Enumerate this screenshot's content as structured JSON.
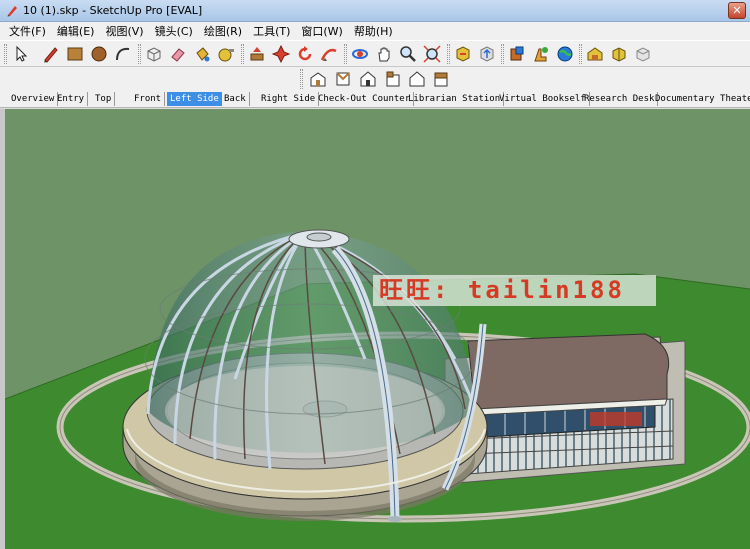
{
  "window": {
    "title": "10 (1).skp - SketchUp Pro [EVAL]",
    "close_glyph": "✕"
  },
  "menu": [
    "文件(F)",
    "编辑(E)",
    "视图(V)",
    "镜头(C)",
    "绘图(R)",
    "工具(T)",
    "窗口(W)",
    "帮助(H)"
  ],
  "toolbar": {
    "tools": [
      "select-icon",
      "pencil-icon",
      "rectangle-icon",
      "circle-icon",
      "arc-icon",
      "make-component-icon",
      "eraser-icon",
      "paint-bucket-icon",
      "tape-measure-icon",
      "push-pull-icon",
      "offset-icon",
      "move-icon",
      "rotate-icon",
      "follow-me-icon",
      "orbit-icon",
      "pan-icon",
      "zoom-icon",
      "zoom-extents-icon",
      "get-models-icon",
      "share-model-icon",
      "share-component-icon",
      "get-photo-texture-icon",
      "google-earth-icon",
      "warehouse-icon",
      "extension-icon",
      "layout-icon"
    ]
  },
  "views": [
    "iso-view-icon",
    "top-view-icon",
    "front-view-icon",
    "right-view-icon",
    "back-view-icon",
    "left-view-icon"
  ],
  "scenes": {
    "tabs": [
      "Overview",
      "Entry",
      "Top",
      "Front",
      "Left Side",
      "Back",
      "Right Side",
      "Check-Out Counter",
      "Librarian Station",
      "Virtual Bookself",
      "Research Desk",
      "Documentary Theater"
    ],
    "active": "Left Side"
  },
  "watermark": "旺旺: tailin188",
  "colors": {
    "sky": "#6e9367",
    "ground": "#3e8a2e",
    "accent_tab": "#3d8ee6",
    "watermark_text": "#d63a24"
  }
}
